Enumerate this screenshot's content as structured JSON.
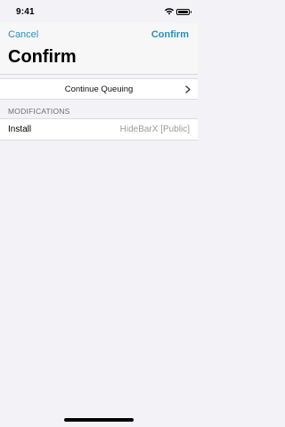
{
  "status_bar": {
    "time": "9:41",
    "icons": [
      "wifi-icon",
      "battery-icon"
    ]
  },
  "nav": {
    "cancel_label": "Cancel",
    "confirm_label": "Confirm",
    "title": "Confirm"
  },
  "continue_row": {
    "label": "Continue Queuing",
    "icon": "chevron-right-icon"
  },
  "modifications": {
    "header": "MODIFICATIONS",
    "items": [
      {
        "label": "Install",
        "value": "HideBarX [Public]"
      }
    ]
  },
  "colors": {
    "accent": "#2a8fbd",
    "background": "#f2f2f7",
    "secondary_text": "#9b9ba0"
  }
}
